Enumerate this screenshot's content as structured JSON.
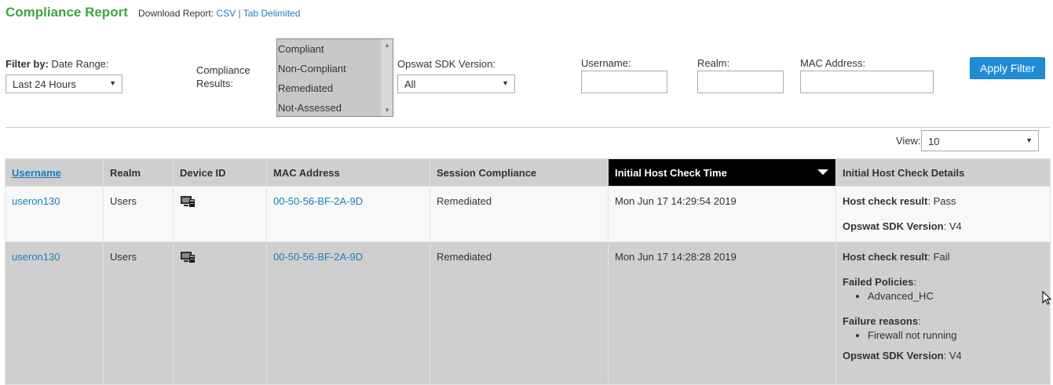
{
  "header": {
    "title": "Compliance Report",
    "download_label": "Download Report:",
    "csv_link": "CSV",
    "separator": "|",
    "tab_link": "Tab Delimited"
  },
  "filters": {
    "filter_by_bold": "Filter by:",
    "date_range_label": "Date Range:",
    "date_range_value": "Last 24 Hours",
    "compliance_label_line1": "Compliance",
    "compliance_label_line2": "Results:",
    "compliance_options": [
      "Compliant",
      "Non-Compliant",
      "Remediated",
      "Not-Assessed"
    ],
    "sdk_label": "Opswat SDK Version:",
    "sdk_value": "All",
    "username_label": "Username:",
    "realm_label": "Realm:",
    "mac_label": "MAC Address:",
    "apply_button": "Apply Filter"
  },
  "view": {
    "label": "View:",
    "value": "10"
  },
  "table": {
    "headers": {
      "username": "Username",
      "realm": "Realm",
      "device_id": "Device ID",
      "mac": "MAC Address",
      "session": "Session Compliance",
      "time": "Initial Host Check Time",
      "details": "Initial Host Check Details"
    },
    "rows": [
      {
        "username": "useron130",
        "realm": "Users",
        "mac": "00-50-56-BF-2A-9D",
        "session": "Remediated",
        "time": "Mon Jun 17 14:29:54 2019",
        "result_label": "Host check result",
        "result_value": ": Pass",
        "sdk_label": "Opswat SDK Version",
        "sdk_value": ": V4"
      },
      {
        "username": "useron130",
        "realm": "Users",
        "mac": "00-50-56-BF-2A-9D",
        "session": "Remediated",
        "time": "Mon Jun 17 14:28:28 2019",
        "result_label": "Host check result",
        "result_value": ": Fail",
        "failed_label": "Failed Policies",
        "failed_colon": ":",
        "failed_item": "Advanced_HC",
        "reasons_label": "Failure reasons",
        "reasons_colon": ":",
        "reasons_item": "Firewall not running",
        "sdk_label": "Opswat SDK Version",
        "sdk_value": ": V4"
      }
    ]
  },
  "colors": {
    "title_green": "#3aa841",
    "link_blue": "#1a7fbd",
    "button_blue": "#1f8dd6",
    "active_header": "#000000",
    "header_gray": "#cfcfcf"
  }
}
